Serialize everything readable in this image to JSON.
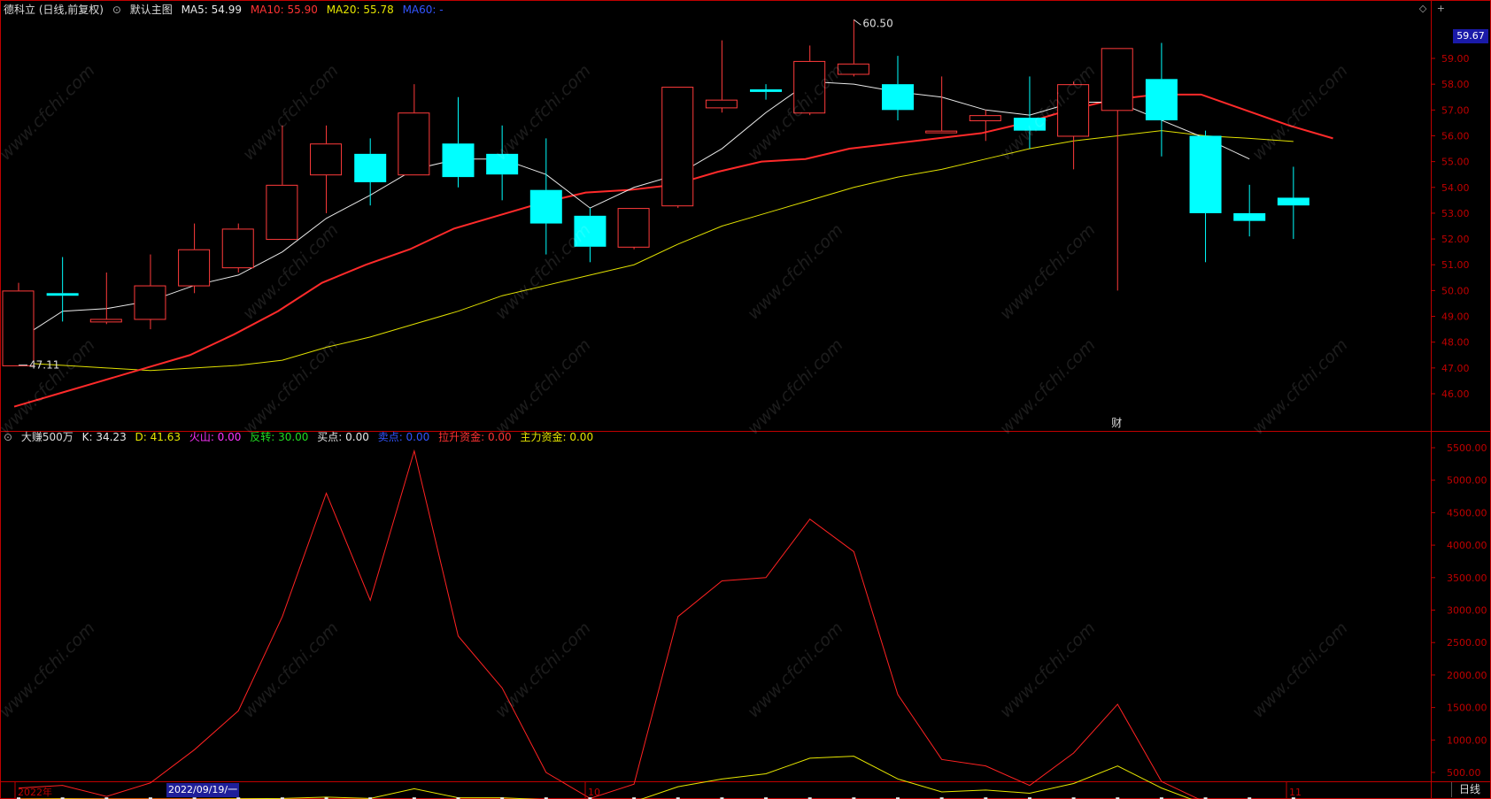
{
  "header": {
    "stock": "德科立 (日线,前复权)",
    "template": "默认主图",
    "ma5": "MA5: 54.99",
    "ma10": "MA10: 55.90",
    "ma20": "MA20: 55.78",
    "ma60": "MA60: -"
  },
  "indicator": {
    "name": "大赚500万",
    "k": "K: 34.23",
    "d": "D: 41.63",
    "huoshan": "火山: 0.00",
    "fanzhuan": "反转: 30.00",
    "maidian": "买点: 0.00",
    "maichu": "卖点: 0.00",
    "lasheng": "拉升资金: 0.00",
    "zhuli": "主力资金: 0.00"
  },
  "price_tag": "59.67",
  "annotations": {
    "high": "60.50",
    "low": "47.11",
    "caibao": "财"
  },
  "axis": {
    "date_start": "2022年",
    "date_selected": "2022/09/19/一",
    "month_10": "10",
    "month_11": "11",
    "period_button": "日线"
  },
  "colors": {
    "up": "#ff3b3b",
    "down": "#00ffff",
    "ma5": "#e8e8e8",
    "ma10": "#ff2a2a",
    "ma20": "#e0e000",
    "axis": "#c00000"
  },
  "chart_data": {
    "type": "candlestick",
    "y_ticks": [
      46,
      47,
      48,
      49,
      50,
      51,
      52,
      53,
      54,
      55,
      56,
      57,
      58,
      59
    ],
    "candles": [
      {
        "o": 47.1,
        "h": 50.3,
        "l": 47.1,
        "c": 50.0
      },
      {
        "o": 49.9,
        "h": 51.3,
        "l": 48.8,
        "c": 49.8
      },
      {
        "o": 48.8,
        "h": 50.7,
        "l": 48.7,
        "c": 48.9
      },
      {
        "o": 48.9,
        "h": 51.4,
        "l": 48.5,
        "c": 50.2
      },
      {
        "o": 50.2,
        "h": 52.6,
        "l": 49.9,
        "c": 51.6
      },
      {
        "o": 50.9,
        "h": 52.6,
        "l": 50.7,
        "c": 52.4
      },
      {
        "o": 52.0,
        "h": 56.4,
        "l": 52.0,
        "c": 54.1
      },
      {
        "o": 54.5,
        "h": 56.4,
        "l": 53.0,
        "c": 55.7
      },
      {
        "o": 55.3,
        "h": 55.9,
        "l": 53.3,
        "c": 54.2
      },
      {
        "o": 54.5,
        "h": 58.0,
        "l": 54.5,
        "c": 56.9
      },
      {
        "o": 55.7,
        "h": 57.5,
        "l": 54.0,
        "c": 54.4
      },
      {
        "o": 55.3,
        "h": 56.4,
        "l": 53.5,
        "c": 54.5
      },
      {
        "o": 53.9,
        "h": 55.9,
        "l": 51.4,
        "c": 52.6
      },
      {
        "o": 52.9,
        "h": 53.2,
        "l": 51.1,
        "c": 51.7
      },
      {
        "o": 51.7,
        "h": 53.2,
        "l": 51.6,
        "c": 53.2
      },
      {
        "o": 53.3,
        "h": 57.9,
        "l": 53.2,
        "c": 57.9
      },
      {
        "o": 57.1,
        "h": 59.7,
        "l": 56.9,
        "c": 57.4
      },
      {
        "o": 57.8,
        "h": 58.0,
        "l": 57.4,
        "c": 57.7
      },
      {
        "o": 56.9,
        "h": 59.5,
        "l": 56.8,
        "c": 58.9
      },
      {
        "o": 58.4,
        "h": 60.5,
        "l": 58.3,
        "c": 58.8
      },
      {
        "o": 58.0,
        "h": 59.1,
        "l": 56.6,
        "c": 57.0
      },
      {
        "o": 56.2,
        "h": 58.3,
        "l": 56.1,
        "c": 56.2
      },
      {
        "o": 56.6,
        "h": 57.0,
        "l": 55.8,
        "c": 56.8
      },
      {
        "o": 56.7,
        "h": 58.3,
        "l": 55.5,
        "c": 56.2
      },
      {
        "o": 56.0,
        "h": 58.1,
        "l": 54.7,
        "c": 58.0
      },
      {
        "o": 57.0,
        "h": 59.4,
        "l": 50.0,
        "c": 59.4
      },
      {
        "o": 58.2,
        "h": 59.6,
        "l": 55.2,
        "c": 56.6
      },
      {
        "o": 56.0,
        "h": 56.2,
        "l": 51.1,
        "c": 53.0
      },
      {
        "o": 53.0,
        "h": 54.1,
        "l": 52.1,
        "c": 52.7
      },
      {
        "o": 53.6,
        "h": 54.8,
        "l": 52.0,
        "c": 53.3
      }
    ],
    "ma5": [
      48.1,
      49.2,
      49.3,
      49.6,
      50.2,
      50.6,
      51.5,
      52.8,
      53.7,
      54.7,
      55.1,
      55.1,
      54.5,
      53.2,
      54.0,
      54.5,
      55.5,
      56.9,
      58.1,
      58.0,
      57.7,
      57.5,
      57.0,
      56.8,
      57.3,
      57.3,
      56.6,
      55.9,
      55.1
    ],
    "ma10": [
      45.5,
      46.0,
      46.5,
      47.0,
      47.5,
      48.3,
      49.2,
      50.3,
      51.0,
      51.6,
      52.4,
      52.9,
      53.4,
      53.8,
      53.9,
      54.1,
      54.6,
      55.0,
      55.1,
      55.5,
      55.7,
      55.9,
      56.1,
      56.5,
      57.0,
      57.4,
      57.6,
      57.6,
      57.0,
      56.4,
      55.9
    ],
    "ma20": [
      47.2,
      47.1,
      47.0,
      46.9,
      47.0,
      47.1,
      47.3,
      47.8,
      48.2,
      48.7,
      49.2,
      49.8,
      50.2,
      50.6,
      51.0,
      51.8,
      52.5,
      53.0,
      53.5,
      54.0,
      54.4,
      54.7,
      55.1,
      55.5,
      55.8,
      56.0,
      56.2,
      56.0,
      55.9,
      55.78
    ],
    "sub_y_ticks": [
      500,
      1000,
      1500,
      2000,
      2500,
      3000,
      3500,
      4000,
      4500,
      5000,
      5500
    ],
    "red_line": [
      260,
      300,
      130,
      340,
      850,
      1450,
      2900,
      4800,
      3150,
      5450,
      2600,
      1800,
      500,
      100,
      320,
      2900,
      3450,
      3500,
      4400,
      3900,
      1700,
      700,
      600,
      300,
      800,
      1550,
      360,
      40,
      20,
      5
    ],
    "yellow_line": [
      90,
      95,
      90,
      90,
      90,
      95,
      100,
      120,
      100,
      250,
      110,
      110,
      80,
      30,
      50,
      280,
      400,
      480,
      720,
      750,
      400,
      200,
      230,
      180,
      330,
      600,
      260,
      5,
      5,
      2
    ],
    "white_line": [
      75,
      75,
      75,
      75,
      75,
      75,
      75,
      80,
      75,
      80,
      75,
      75,
      70,
      60,
      60,
      70,
      75,
      75,
      75,
      75,
      75,
      70,
      70,
      60,
      70,
      75,
      70,
      50,
      50,
      50
    ]
  }
}
